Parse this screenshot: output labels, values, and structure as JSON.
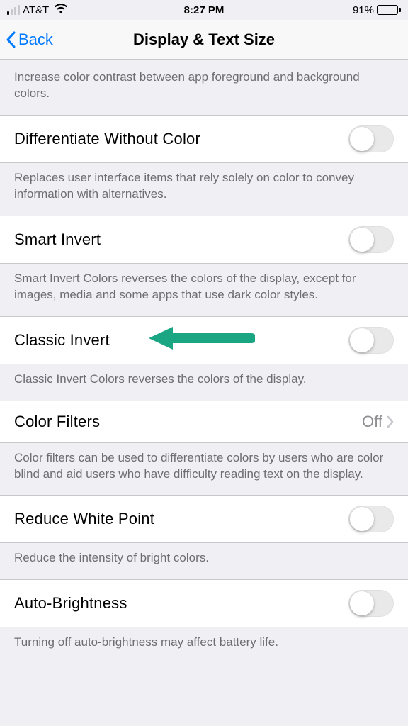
{
  "status": {
    "carrier": "AT&T",
    "time": "8:27 PM",
    "battery_pct": "91%"
  },
  "nav": {
    "back": "Back",
    "title": "Display & Text Size"
  },
  "footers": {
    "contrast": "Increase color contrast between app foreground and background colors.",
    "diff_color": "Replaces user interface items that rely solely on color to convey information with alternatives.",
    "smart_invert": "Smart Invert Colors reverses the colors of the display, except for images, media and some apps that use dark color styles.",
    "classic_invert": "Classic Invert Colors reverses the colors of the display.",
    "color_filters": "Color filters can be used to differentiate colors by users who are color blind and aid users who have difficulty reading text on the display.",
    "reduce_white": "Reduce the intensity of bright colors.",
    "auto_bright": "Turning off auto-brightness may affect battery life."
  },
  "rows": {
    "diff_color": "Differentiate Without Color",
    "smart_invert": "Smart Invert",
    "classic_invert": "Classic Invert",
    "color_filters": "Color Filters",
    "color_filters_value": "Off",
    "reduce_white": "Reduce White Point",
    "auto_bright": "Auto-Brightness"
  }
}
